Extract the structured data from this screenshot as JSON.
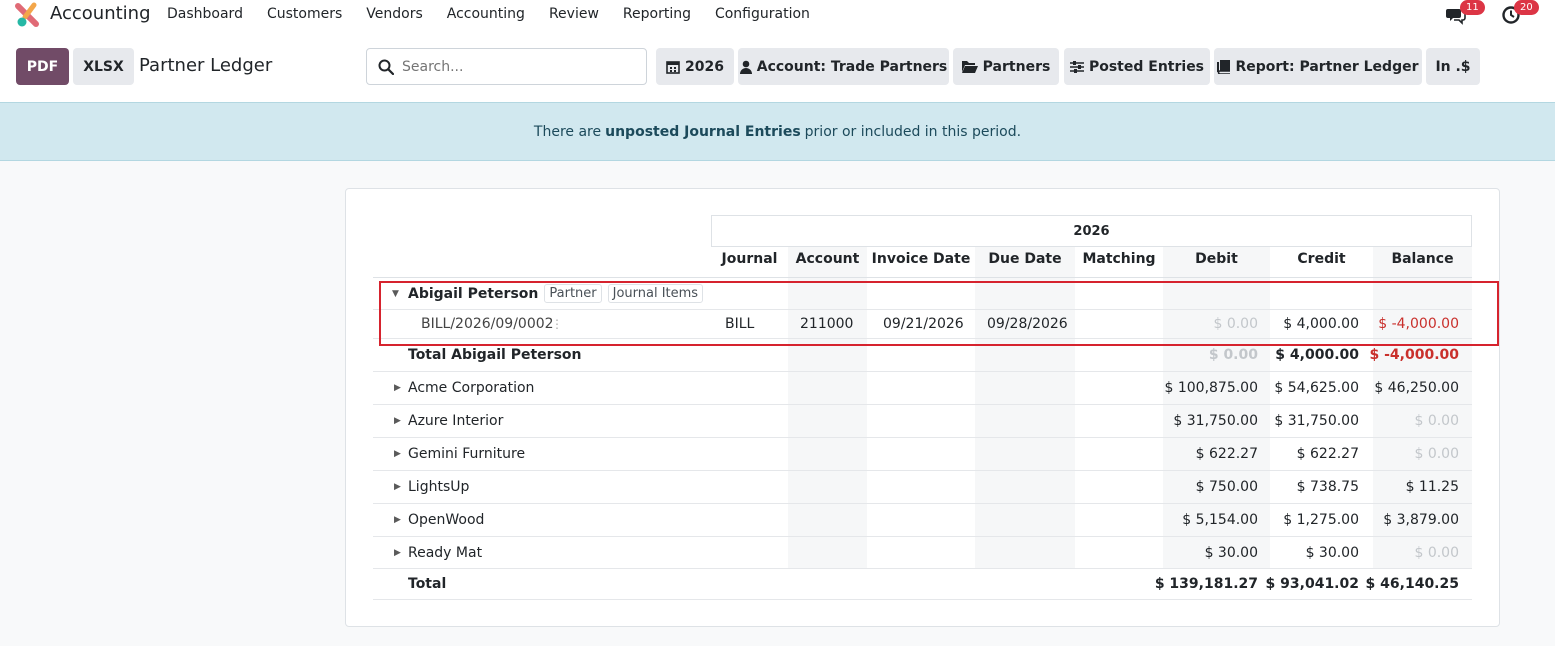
{
  "app": {
    "name": "Accounting"
  },
  "nav": [
    "Dashboard",
    "Customers",
    "Vendors",
    "Accounting",
    "Review",
    "Reporting",
    "Configuration"
  ],
  "systray": {
    "messages_count": "11",
    "activities_count": "20"
  },
  "control": {
    "pdf_label": "PDF",
    "xlsx_label": "XLSX",
    "title": "Partner Ledger",
    "search_placeholder": "Search...",
    "filters": [
      {
        "icon": "calendar-icon",
        "label": "2026"
      },
      {
        "icon": "user-icon",
        "label": "Account: Trade Partners"
      },
      {
        "icon": "folder-open-icon",
        "label": "Partners"
      },
      {
        "icon": "sliders-icon",
        "label": "Posted Entries"
      },
      {
        "icon": "book-icon",
        "label": "Report: Partner Ledger"
      },
      {
        "icon": "",
        "label": "In .$"
      }
    ]
  },
  "alert": {
    "prefix": "There are",
    "link": "unposted Journal Entries",
    "suffix": "prior or included in this period."
  },
  "report": {
    "period": "2026",
    "columns": [
      "Journal",
      "Account",
      "Invoice Date",
      "Due Date",
      "Matching",
      "Debit",
      "Credit",
      "Balance"
    ],
    "expanded_partner": {
      "name": "Abigail Peterson",
      "tags": [
        "Partner",
        "Journal Items"
      ],
      "line": {
        "ref": "BILL/2026/09/0002",
        "journal": "BILL",
        "account": "211000",
        "invoice_date": "09/21/2026",
        "due_date": "09/28/2026",
        "debit": "$ 0.00",
        "credit": "$ 4,000.00",
        "balance": "$ -4,000.00"
      },
      "total_label": "Total Abigail Peterson",
      "total": {
        "debit": "$ 0.00",
        "credit": "$ 4,000.00",
        "balance": "$ -4,000.00"
      }
    },
    "partners": [
      {
        "name": "Acme Corporation",
        "debit": "$ 100,875.00",
        "credit": "$ 54,625.00",
        "balance": "$ 46,250.00"
      },
      {
        "name": "Azure Interior",
        "debit": "$ 31,750.00",
        "credit": "$ 31,750.00",
        "balance": "$ 0.00"
      },
      {
        "name": "Gemini Furniture",
        "debit": "$ 622.27",
        "credit": "$ 622.27",
        "balance": "$ 0.00"
      },
      {
        "name": "LightsUp",
        "debit": "$ 750.00",
        "credit": "$ 738.75",
        "balance": "$ 11.25"
      },
      {
        "name": "OpenWood",
        "debit": "$ 5,154.00",
        "credit": "$ 1,275.00",
        "balance": "$ 3,879.00"
      },
      {
        "name": "Ready Mat",
        "debit": "$ 30.00",
        "credit": "$ 30.00",
        "balance": "$ 0.00"
      }
    ],
    "grand_total": {
      "label": "Total",
      "debit": "$ 139,181.27",
      "credit": "$ 93,041.02",
      "balance": "$ 46,140.25"
    }
  }
}
